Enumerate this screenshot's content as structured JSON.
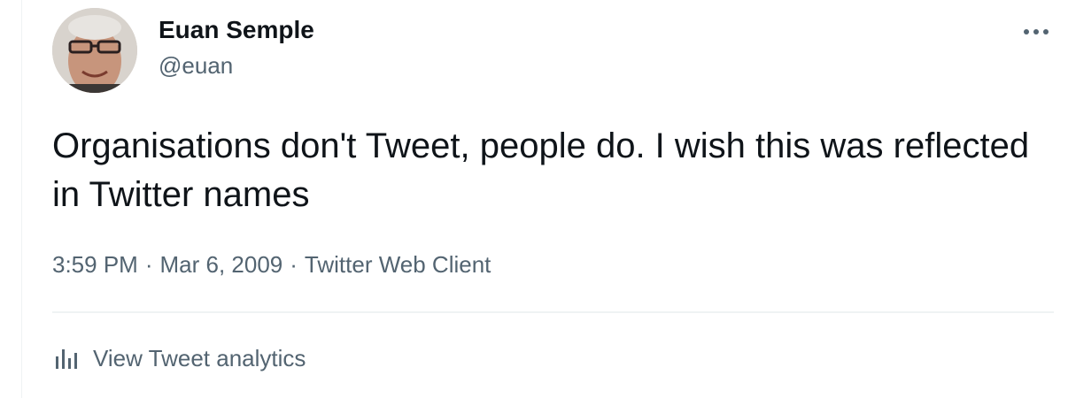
{
  "author": {
    "name": "Euan Semple",
    "handle": "@euan",
    "avatar_icon": "profile-photo"
  },
  "tweet": {
    "text": "Organisations don't Tweet, people do. I wish this was reflected in Twitter names"
  },
  "meta": {
    "time": "3:59 PM",
    "date": "Mar 6, 2009",
    "client": "Twitter Web Client",
    "separator": "·"
  },
  "actions": {
    "more_icon": "more-horizontal-icon",
    "analytics_label": "View Tweet analytics",
    "analytics_icon": "bar-chart-icon"
  },
  "colors": {
    "primary_text": "#0f1419",
    "secondary_text": "#536471",
    "divider": "#eff3f4"
  }
}
